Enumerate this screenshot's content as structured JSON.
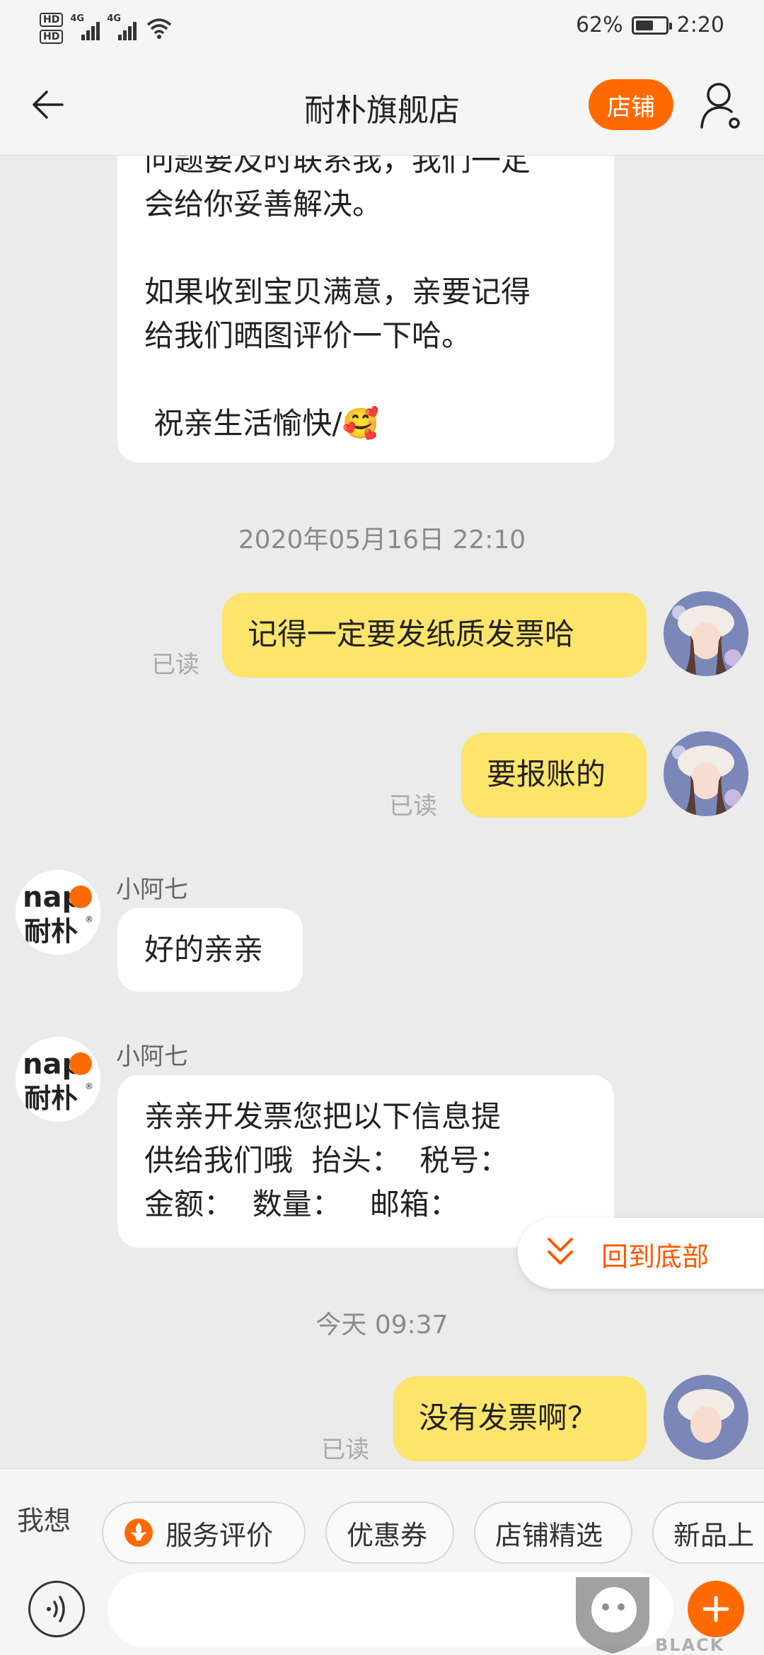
{
  "status_bar": {
    "network_left": "4G",
    "network_right": "4G",
    "hd1": "HD",
    "hd2": "HD",
    "battery": "62%",
    "battery_level": 0.62,
    "time": "2:20"
  },
  "header": {
    "title": "耐朴旗舰店",
    "shop_button": "店铺"
  },
  "messages": [
    {
      "type": "white_bubble",
      "lines": "问题要及时联系我，我们一定\n会给你妥善解决。\n\n如果收到宝贝满意，亲要记得\n给我们晒图评价一下哈。\n\n 祝亲生活愉快/🥰"
    },
    {
      "type": "timestamp",
      "text": "2020年05月16日 22:10"
    },
    {
      "type": "yellow_bubble",
      "text": "记得一定要发纸质发票哈",
      "status": "已读"
    },
    {
      "type": "yellow_bubble",
      "text": "要报账的",
      "status": "已读"
    },
    {
      "type": "shop_message",
      "sender": "小阿七",
      "text": "好的亲亲"
    },
    {
      "type": "shop_message",
      "sender": "小阿七",
      "text": "亲亲开发票您把以下信息提\n供给我们哦  抬头：  税号：\n金额：  数量：   邮箱："
    },
    {
      "type": "timestamp",
      "text": "今天  09:37"
    },
    {
      "type": "yellow_bubble",
      "text": "没有发票啊？",
      "status": "已读"
    }
  ],
  "shop_logo": {
    "top": "nap",
    "bottom": "耐朴",
    "mark": "®"
  },
  "back_to_bottom": "回到底部",
  "quick_bar": {
    "label": "我想",
    "chips": [
      "服务评价",
      "优惠券",
      "店铺精选",
      "新品上"
    ]
  },
  "input": {
    "value": "",
    "placeholder": ""
  },
  "watermark": {
    "text": "BLACK CAT"
  },
  "colors": {
    "accent": "#ff6a00",
    "my_bubble": "#fde46b",
    "background": "#ebebeb"
  }
}
